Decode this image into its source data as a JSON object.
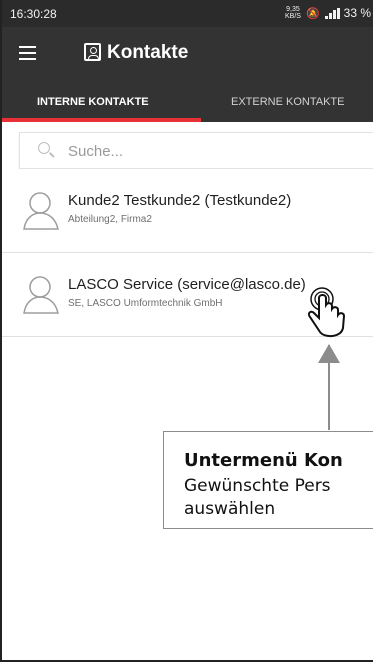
{
  "status_bar": {
    "time": "16:30:28",
    "speed_value": "9,35",
    "speed_unit": "KB/S",
    "battery": "33 %"
  },
  "app_bar": {
    "title": "Kontakte",
    "menu_icon": "hamburger-menu-icon",
    "title_icon": "contact-book-icon"
  },
  "tabs": {
    "items": [
      {
        "label": "INTERNE KONTAKTE",
        "selected": true
      },
      {
        "label": "EXTERNE KONTAKTE",
        "selected": false
      }
    ]
  },
  "search": {
    "placeholder": "Suche...",
    "icon": "search-icon"
  },
  "contacts": [
    {
      "name": "Kunde2 Testkunde2 (Testkunde2)",
      "detail": "Abteilung2, Firma2",
      "avatar_icon": "person-icon"
    },
    {
      "name": "LASCO Service (service@lasco.de)",
      "detail": "SE, LASCO Umformtechnik GmbH",
      "avatar_icon": "person-icon"
    }
  ],
  "annotation": {
    "title": "Untermenü Kon",
    "line_1": "Gewünschte Pers",
    "line_2": "auswählen",
    "pointer_icon": "hand-pointer-icon"
  },
  "colors": {
    "status_bar": "#2b2b2b",
    "app_bar": "#333333",
    "accent": "#e83035",
    "text": "#1f1f1f",
    "muted_text": "#6f6f6f",
    "border": "#e0e0e0"
  }
}
